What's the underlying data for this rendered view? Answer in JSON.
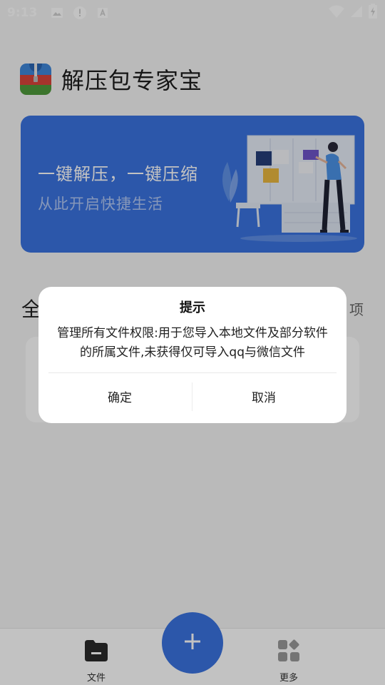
{
  "status_bar": {
    "time": "9:13",
    "icons": [
      "image-icon",
      "alert-icon",
      "a-box-icon"
    ],
    "right_icons": [
      "wifi-icon",
      "signal-icon",
      "battery-charging-icon"
    ]
  },
  "header": {
    "app_title": "解压包专家宝",
    "logo": "zip-archive-icon"
  },
  "banner": {
    "title": "一键解压，一键压缩",
    "subtitle": "从此开启快捷生活",
    "background": "#3b73e0"
  },
  "section": {
    "title_partial": "全",
    "action_partial": "项"
  },
  "bottom_nav": {
    "items": [
      {
        "label": "文件",
        "icon": "folder-icon"
      },
      {
        "label": "更多",
        "icon": "more-apps-icon"
      }
    ],
    "fab_icon": "plus-icon",
    "accent": "#3b73e0"
  },
  "dialog": {
    "title": "提示",
    "message_line1": "管理所有文件权限:用于您导入本地文件及部分软件",
    "message_line2": "的所属文件,未获得仅可导入qq与微信文件",
    "confirm_label": "确定",
    "cancel_label": "取消"
  }
}
